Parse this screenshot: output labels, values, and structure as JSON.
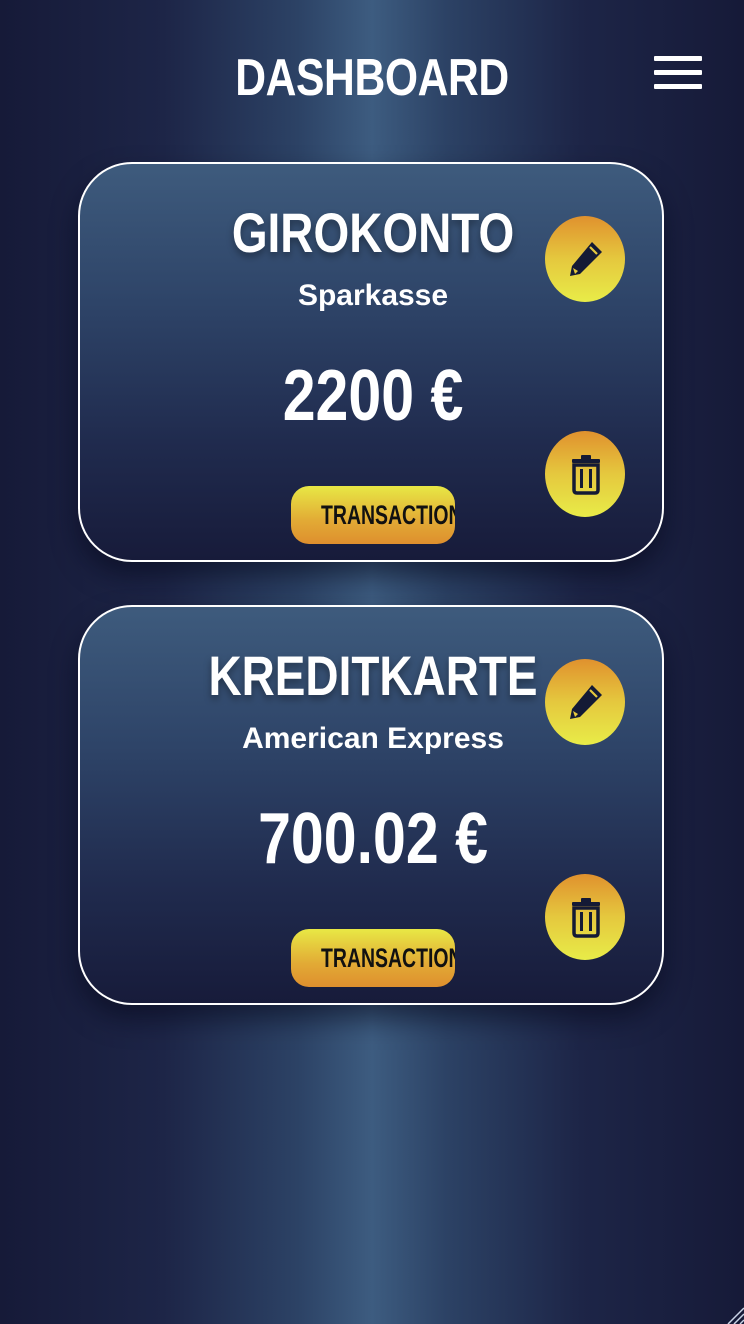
{
  "header": {
    "title": "DASHBOARD",
    "menu_icon": "hamburger-menu-icon"
  },
  "accounts": [
    {
      "name": "GIROKONTO",
      "bank": "Sparkasse",
      "balance": "2200 €",
      "transactions_label": "TRANSACTIONS",
      "edit_icon": "pencil-icon",
      "delete_icon": "trash-icon"
    },
    {
      "name": "KREDITKARTE",
      "bank": "American Express",
      "balance": "700.02 €",
      "transactions_label": "TRANSACTIONS",
      "edit_icon": "pencil-icon",
      "delete_icon": "trash-icon"
    }
  ],
  "colors": {
    "background_dark": "#161a38",
    "background_light": "#3d5c80",
    "accent_yellow": "#e8ec48",
    "accent_orange": "#de8f2e",
    "text": "#ffffff"
  }
}
